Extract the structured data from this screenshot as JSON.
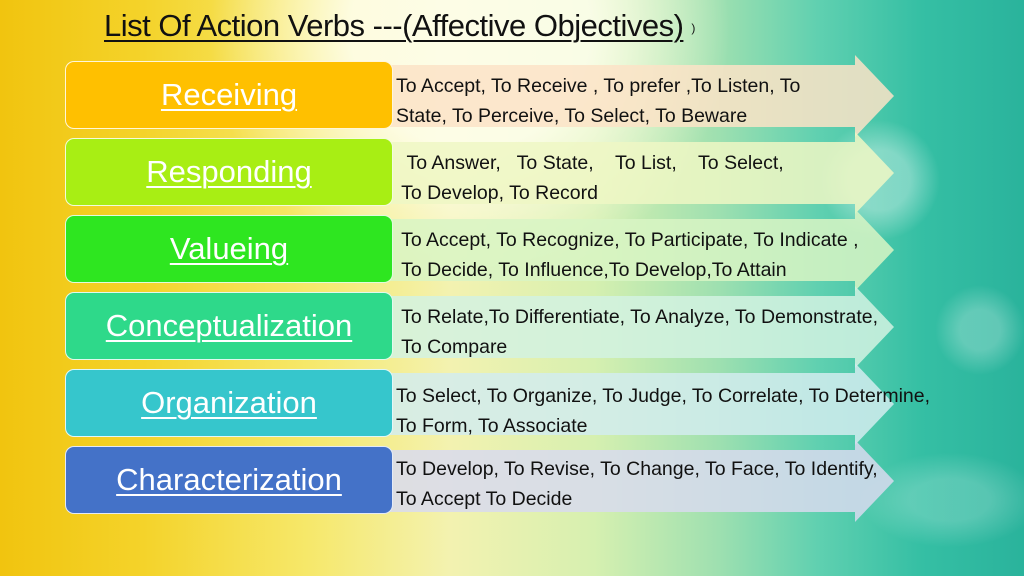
{
  "title": {
    "main": "List  Of Action Verbs ---(Affective Objectives)",
    "tail": ")"
  },
  "rows": [
    {
      "label": "Receiving",
      "color": "#ffc000",
      "arrow_color": "#fbe3c7",
      "line1": "To Accept, To Receive , To prefer ,To Listen, To",
      "line2": "State, To Perceive, To Select, To Beware"
    },
    {
      "label": "Responding",
      "color": "#a8ee14",
      "arrow_color": "#eef7c4",
      "line1": "  To Answer,   To State,    To List,    To Select,",
      "line2": " To Develop, To Record"
    },
    {
      "label": "Valueing",
      "color": "#2ee620",
      "arrow_color": "#d8f4c4",
      "line1": " To Accept, To Recognize, To Participate, To Indicate ,",
      "line2": " To Decide, To Influence,To Develop,To Attain"
    },
    {
      "label": "Conceptualization",
      "color": "#2ed98a",
      "arrow_color": "#d2f2e2",
      "line1": " To Relate,To Differentiate, To Analyze, To Demonstrate,",
      "line2": " To Compare"
    },
    {
      "label": "Organization",
      "color": "#36c6cc",
      "arrow_color": "#d2ecee",
      "line1": "To Select, To Organize, To Judge, To Correlate, To Determine,",
      "line2": "To Form, To Associate"
    },
    {
      "label": "Characterization",
      "color": "#4472c8",
      "arrow_color": "#d8dbee",
      "line1": "To Develop, To Revise, To Change, To Face, To Identify,",
      "line2": "To Accept To Decide"
    }
  ]
}
